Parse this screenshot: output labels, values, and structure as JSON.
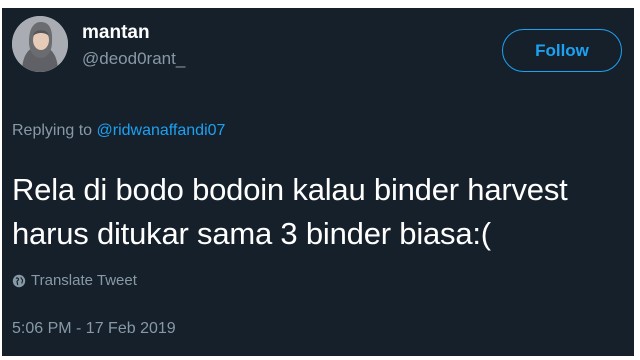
{
  "user": {
    "display_name": "mantan",
    "handle": "@deod0rant_"
  },
  "follow_button": {
    "label": "Follow"
  },
  "reply": {
    "prefix": "Replying to ",
    "mention": "@ridwanaffandi07"
  },
  "tweet": {
    "line1": "Rela di bodo bodoin kalau binder harvest",
    "line2": "harus ditukar sama 3 binder biasa:("
  },
  "translate": {
    "label": "Translate Tweet",
    "icon": "globe-icon"
  },
  "timestamp": "5:06 PM - 17 Feb 2019",
  "colors": {
    "background": "#15202b",
    "accent": "#1da1f2",
    "secondary_text": "#8899a6",
    "primary_text": "#ffffff"
  }
}
